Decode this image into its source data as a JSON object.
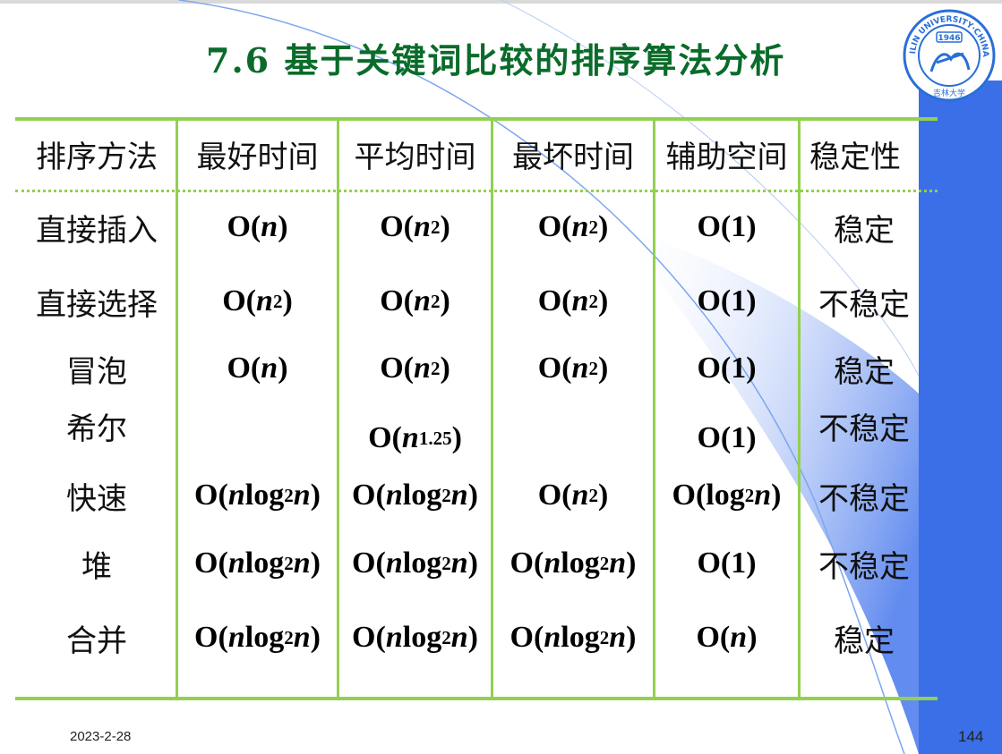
{
  "slide": {
    "title": "7.6 基于关键词比较的排序算法分析",
    "date": "2023-2-28",
    "page_number": "144",
    "logo": {
      "icon": "university-seal-icon",
      "text_top": "JILIN UNIVERSITY·CHINA",
      "year": "1946",
      "text_bottom": "吉林大学"
    }
  },
  "colors": {
    "title": "#0a6b2a",
    "table_lines": "#92d050",
    "decoration_blue": "#3b6fe8"
  },
  "table": {
    "headers": [
      "排序方法",
      "最好时间",
      "平均时间",
      "最坏时间",
      "辅助空间",
      "稳定性"
    ],
    "rows": [
      {
        "method": "直接插入",
        "best": "O(n)",
        "avg": "O(n2)",
        "worst": "O(n2)",
        "space": "O(1)",
        "stable": "稳定"
      },
      {
        "method": "直接选择",
        "best": "O(n2)",
        "avg": "O(n2)",
        "worst": "O(n2)",
        "space": "O(1)",
        "stable": "不稳定"
      },
      {
        "method": "冒泡",
        "best": "O(n)",
        "avg": "O(n2)",
        "worst": "O(n2)",
        "space": "O(1)",
        "stable": "稳定"
      },
      {
        "method": "希尔",
        "best": "",
        "avg": "O(n1.25)",
        "worst": "",
        "space": "O(1)",
        "stable": "不稳定"
      },
      {
        "method": "快速",
        "best": "O(nlog2n)",
        "avg": "O(nlog2n)",
        "worst": "O(n2)",
        "space": "O(log2n)",
        "stable": "不稳定"
      },
      {
        "method": "堆",
        "best": "O(nlog2n)",
        "avg": "O(nlog2n)",
        "worst": "O(nlog2n)",
        "space": "O(1)",
        "stable": "不稳定"
      },
      {
        "method": "合并",
        "best": "O(nlog2n)",
        "avg": "O(nlog2n)",
        "worst": "O(nlog2n)",
        "space": "O(n)",
        "stable": "稳定"
      }
    ]
  }
}
